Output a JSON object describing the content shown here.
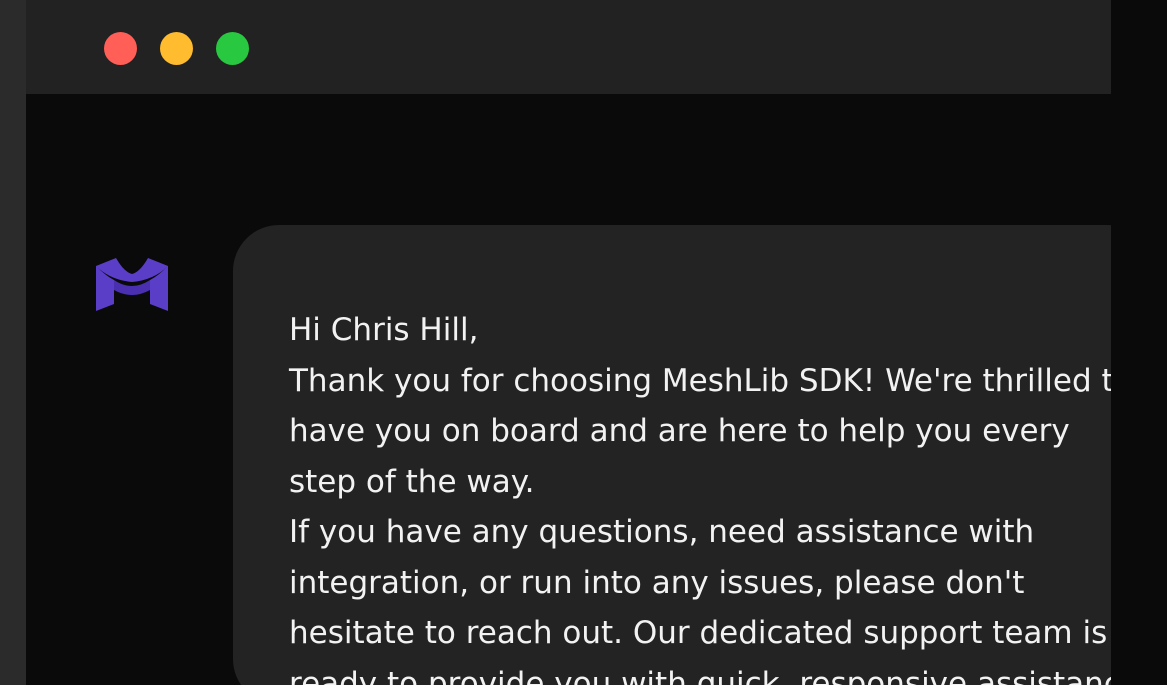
{
  "window": {
    "controls": {
      "close_color": "#ff5f57",
      "minimize_color": "#febc2e",
      "maximize_color": "#28c840"
    }
  },
  "logo": {
    "icon": "meshlib-logo-icon",
    "color": "#5b3ec8"
  },
  "message": {
    "lines": [
      "Hi Chris Hill,",
      "Thank you for choosing MeshLib SDK! We're thrilled to",
      "have you on board and are here to help you every",
      "step of the way.",
      "If you have any questions, need assistance with",
      "integration, or run into any issues, please don't",
      "hesitate to reach out. Our dedicated support team is",
      "ready to provide you with quick, responsive assistance."
    ]
  }
}
